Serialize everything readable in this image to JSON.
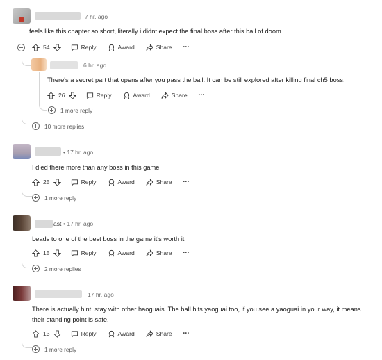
{
  "comments": [
    {
      "time": "7 hr. ago",
      "text": "feels like this chapter so short, literally i didnt expect the final boss after this ball of doom",
      "votes": "54",
      "reply_label": "Reply",
      "award_label": "Award",
      "share_label": "Share",
      "more_label": "•••"
    },
    {
      "time": "6 hr. ago",
      "text": "There's a secret part that opens after you pass the ball. It can be still explored after killing final ch5 boss.",
      "votes": "26",
      "reply_label": "Reply",
      "award_label": "Award",
      "share_label": "Share",
      "more_label": "•••",
      "replies_link": "1 more reply"
    },
    {
      "thread_replies_link": "10 more replies"
    },
    {
      "time": "• 17 hr. ago",
      "text": "I died there more than any boss in this game",
      "votes": "25",
      "reply_label": "Reply",
      "award_label": "Award",
      "share_label": "Share",
      "more_label": "•••",
      "replies_link": "1 more reply"
    },
    {
      "username_tail": "ast",
      "time": "• 17 hr. ago",
      "text": "Leads to one of the best boss in the game it's worth it",
      "votes": "15",
      "reply_label": "Reply",
      "award_label": "Award",
      "share_label": "Share",
      "more_label": "•••",
      "replies_link": "2 more replies"
    },
    {
      "time": "17 hr. ago",
      "text_line1": "There is actually hint: stay with other haoguais. The ball hits yaoguai too, if you see a yaoguai in your way, it means",
      "text_line2": "their standing point is safe.",
      "votes": "13",
      "reply_label": "Reply",
      "award_label": "Award",
      "share_label": "Share",
      "more_label": "•••",
      "replies_link": "1 more reply"
    }
  ]
}
